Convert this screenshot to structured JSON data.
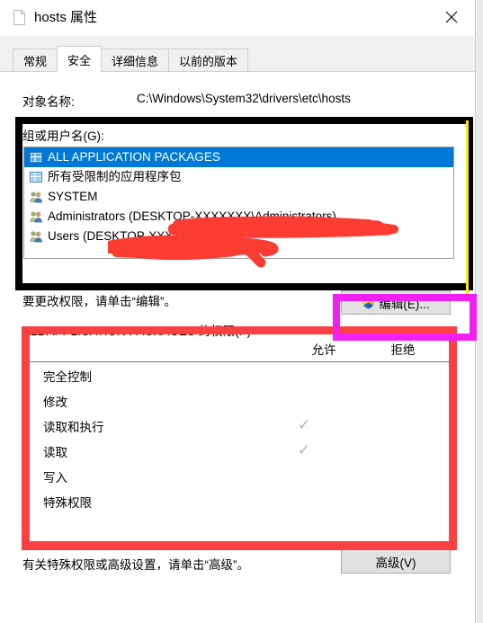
{
  "window": {
    "title": "hosts 属性",
    "file_icon": "file-icon",
    "close_label": "×"
  },
  "tabs": [
    {
      "label": "常规",
      "active": false
    },
    {
      "label": "安全",
      "active": true
    },
    {
      "label": "详细信息",
      "active": false
    },
    {
      "label": "以前的版本",
      "active": false
    }
  ],
  "security": {
    "object_label": "对象名称:",
    "object_path": "C:\\Windows\\System32\\drivers\\etc\\hosts",
    "group_label": "组或用户名(G):",
    "users": [
      {
        "name": "ALL APPLICATION PACKAGES",
        "icon": "app-package-icon",
        "selected": true,
        "redacted": false
      },
      {
        "name": "所有受限制的应用程序包",
        "icon": "app-package-icon",
        "selected": false,
        "redacted": false
      },
      {
        "name": "SYSTEM",
        "icon": "group-users-icon",
        "selected": false,
        "redacted": false
      },
      {
        "name": "Administrators (DESKTOP-XXXXXXX\\Administrators)",
        "icon": "group-users-icon",
        "selected": false,
        "redacted": true
      },
      {
        "name": "Users (DESKTOP-XXXXXXX\\Users)",
        "icon": "group-users-icon",
        "selected": false,
        "redacted": true
      }
    ],
    "edit_hint": "要更改权限，请单击“编辑”。",
    "edit_button": "编辑(E)...",
    "edit_button_icon": "uac-shield-icon",
    "permissions_title": "ALL APPLICATION PACKAGES 的权限(P)",
    "column_allow": "允许",
    "column_deny": "拒绝",
    "permissions": [
      {
        "name": "完全控制",
        "allow": false,
        "deny": false
      },
      {
        "name": "修改",
        "allow": false,
        "deny": false
      },
      {
        "name": "读取和执行",
        "allow": true,
        "deny": false
      },
      {
        "name": "读取",
        "allow": true,
        "deny": false
      },
      {
        "name": "写入",
        "allow": false,
        "deny": false
      },
      {
        "name": "特殊权限",
        "allow": false,
        "deny": false
      }
    ],
    "check_glyph": "✓",
    "advanced_hint": "有关特殊权限或高级设置，请单击“高级”。",
    "advanced_button": "高级(V)"
  },
  "annotations": {
    "black_box_color": "#000000",
    "yellow_line_color": "#ffea00",
    "magenta_box_color": "#f020f0",
    "red_box_color": "#fa4040",
    "redaction_color": "#fa3c32"
  },
  "colors": {
    "selection_blue": "#0078d7",
    "tab_strip": "#f0f0f0",
    "button_face": "#e1e1e1",
    "check_gray": "#b4b4b4"
  }
}
